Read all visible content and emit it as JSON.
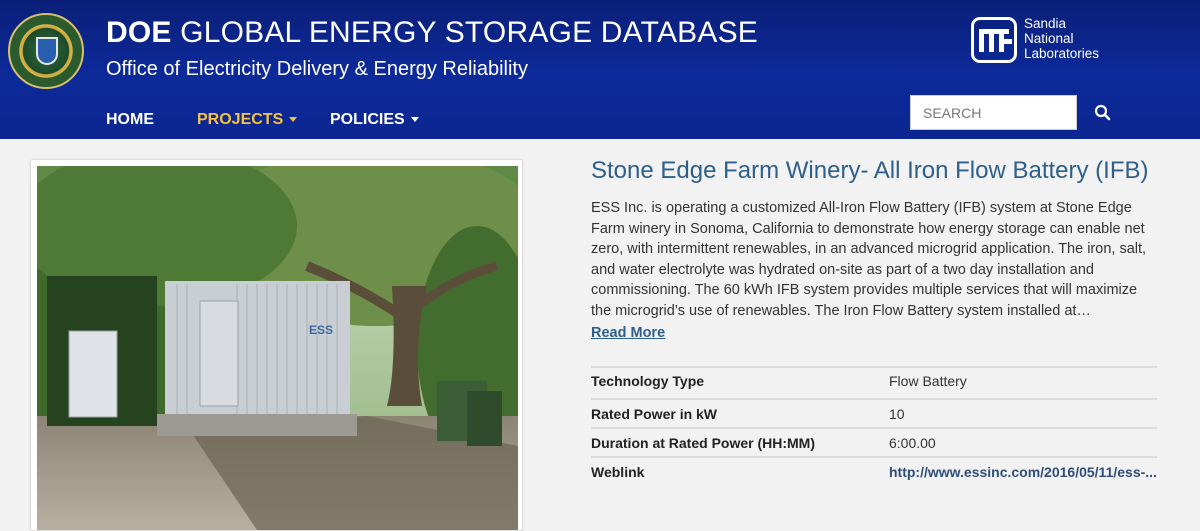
{
  "header": {
    "title_bold": "DOE",
    "title_rest": " GLOBAL ENERGY STORAGE DATABASE",
    "subtitle": "Office of Electricity Delivery & Energy Reliability",
    "partner_logo_lines": [
      "Sandia",
      "National",
      "Laboratories"
    ],
    "seal_icon": "doe-seal-icon",
    "colors": {
      "header_bg": "#0d2a9a",
      "nav_active": "#f5c242",
      "link": "#2e5f8a"
    }
  },
  "nav": {
    "items": [
      {
        "label": "HOME",
        "has_dropdown": false,
        "active": false
      },
      {
        "label": "PROJECTS",
        "has_dropdown": true,
        "active": true
      },
      {
        "label": "POLICIES",
        "has_dropdown": true,
        "active": false
      }
    ]
  },
  "search": {
    "placeholder": "SEARCH",
    "value": "",
    "icon": "search-icon"
  },
  "project": {
    "title": "Stone Edge Farm Winery- All Iron Flow Battery (IFB)",
    "description": "ESS Inc. is operating a customized All-Iron Flow Battery (IFB) system at Stone Edge Farm winery in Sonoma, California to demonstrate how energy storage can enable net zero, with intermittent renewables, in an advanced microgrid application. The iron, salt, and water electrolyte was hydrated on-site as part of a two day installation and commissioning. The 60 kWh IFB system provides multiple services that will maximize the microgrid’s use of renewables. The Iron Flow Battery system installed at…",
    "read_more": "Read More",
    "photo_container_label": "ESS",
    "details": [
      {
        "label": "Technology Type",
        "value": "Flow Battery"
      },
      {
        "label": "Rated Power in kW",
        "value": "10"
      },
      {
        "label": "Duration at Rated Power (HH:MM)",
        "value": "6:00.00"
      },
      {
        "label": "Weblink",
        "value": "http://www.essinc.com/2016/05/11/ess-..."
      }
    ]
  }
}
